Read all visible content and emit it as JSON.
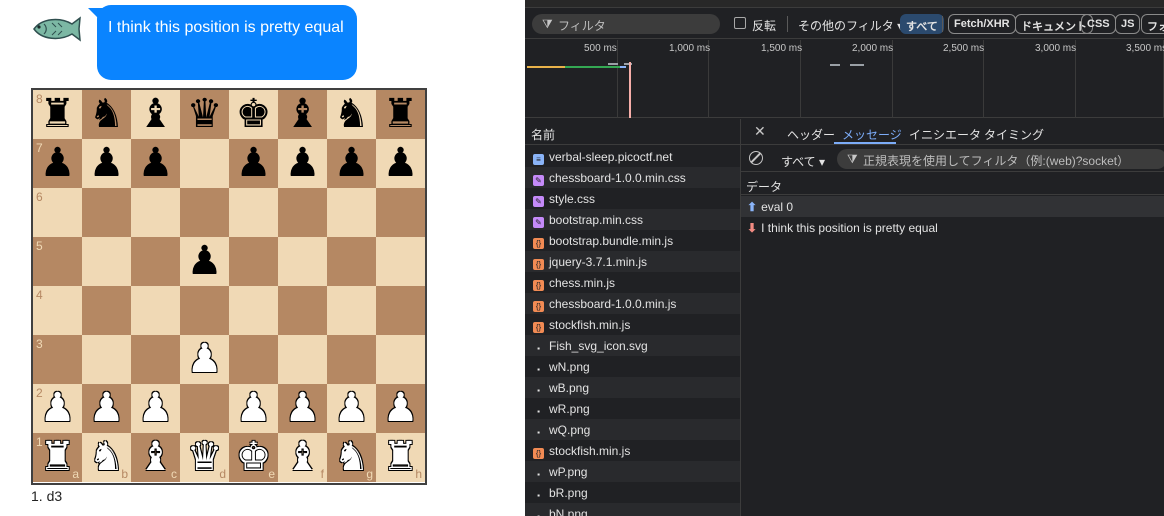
{
  "chat": {
    "avatar_icon": "fish-icon",
    "message": "I think this position is pretty equal"
  },
  "board": {
    "ranks": [
      "8",
      "7",
      "6",
      "5",
      "4",
      "3",
      "2",
      "1"
    ],
    "files": [
      "a",
      "b",
      "c",
      "d",
      "e",
      "f",
      "g",
      "h"
    ],
    "position": [
      [
        "bR",
        "bN",
        "bB",
        "bQ",
        "bK",
        "bB",
        "bN",
        "bR"
      ],
      [
        "bP",
        "bP",
        "bP",
        "",
        "bP",
        "bP",
        "bP",
        "bP"
      ],
      [
        "",
        "",
        "",
        "",
        "",
        "",
        "",
        ""
      ],
      [
        "",
        "",
        "",
        "bP",
        "",
        "",
        "",
        ""
      ],
      [
        "",
        "",
        "",
        "",
        "",
        "",
        "",
        ""
      ],
      [
        "",
        "",
        "",
        "wP",
        "",
        "",
        "",
        ""
      ],
      [
        "wP",
        "wP",
        "wP",
        "",
        "wP",
        "wP",
        "wP",
        "wP"
      ],
      [
        "wR",
        "wN",
        "wB",
        "wQ",
        "wK",
        "wB",
        "wN",
        "wR"
      ]
    ],
    "light_color": "#f0d9b5",
    "dark_color": "#b58863"
  },
  "moves": "1. d3",
  "devtools": {
    "filter_placeholder": "フィルタ",
    "invert_label": "反転",
    "other_filters_label": "その他のフィルタ ▾",
    "type_chips": [
      "すべて",
      "Fetch/XHR",
      "ドキュメント",
      "CSS",
      "JS",
      "フォ"
    ],
    "timeline_ticks": [
      "500 ms",
      "1,000 ms",
      "1,500 ms",
      "2,000 ms",
      "2,500 ms",
      "3,000 ms",
      "3,500 ms"
    ],
    "name_header": "名前",
    "requests": [
      {
        "name": "verbal-sleep.picoctf.net",
        "type": "doc"
      },
      {
        "name": "chessboard-1.0.0.min.css",
        "type": "css"
      },
      {
        "name": "style.css",
        "type": "css"
      },
      {
        "name": "bootstrap.min.css",
        "type": "css"
      },
      {
        "name": "bootstrap.bundle.min.js",
        "type": "js"
      },
      {
        "name": "jquery-3.7.1.min.js",
        "type": "js"
      },
      {
        "name": "chess.min.js",
        "type": "js"
      },
      {
        "name": "chessboard-1.0.0.min.js",
        "type": "js"
      },
      {
        "name": "stockfish.min.js",
        "type": "js"
      },
      {
        "name": "Fish_svg_icon.svg",
        "type": "img"
      },
      {
        "name": "wN.png",
        "type": "img"
      },
      {
        "name": "wB.png",
        "type": "img"
      },
      {
        "name": "wR.png",
        "type": "img"
      },
      {
        "name": "wQ.png",
        "type": "img"
      },
      {
        "name": "stockfish.min.js",
        "type": "js"
      },
      {
        "name": "wP.png",
        "type": "img"
      },
      {
        "name": "bR.png",
        "type": "img"
      },
      {
        "name": "bN.png",
        "type": "img"
      }
    ],
    "tabs": [
      "ヘッダー",
      "メッセージ",
      "イニシエータ",
      "タイミング"
    ],
    "active_tab": "メッセージ",
    "message_type_select": "すべて ▾",
    "message_filter_placeholder": "正規表現を使用してフィルタ（例:(web)?socket）",
    "data_header": "データ",
    "messages": [
      {
        "direction": "sent",
        "text": "eval 0"
      },
      {
        "direction": "received",
        "text": "I think this position is pretty equal"
      }
    ]
  }
}
